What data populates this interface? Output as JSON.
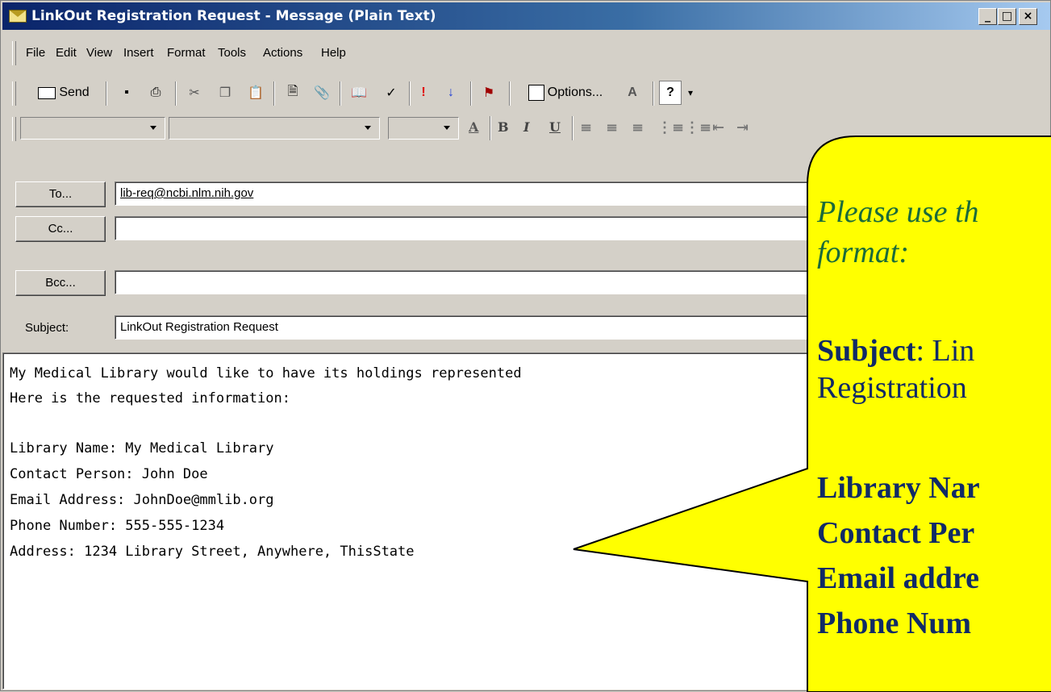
{
  "window": {
    "title": "LinkOut Registration Request - Message (Plain Text)"
  },
  "caption_buttons": {
    "minimize": "_",
    "maximize": "□",
    "close": "×"
  },
  "menu": [
    "File",
    "Edit",
    "View",
    "Insert",
    "Format",
    "Tools",
    "Actions",
    "Help"
  ],
  "toolbar": {
    "send_label": "Send",
    "options_label": "Options...",
    "icons": [
      "save-icon",
      "print-icon",
      "cut-icon",
      "copy-icon",
      "paste-icon",
      "insert-file-icon",
      "attach-icon",
      "address-book-icon",
      "check-names-icon",
      "importance-high-icon",
      "importance-low-icon",
      "flag-icon",
      "options-icon",
      "font-size-icon",
      "help-icon"
    ]
  },
  "formatting": {
    "font_color": "A",
    "bold": "B",
    "italic": "I",
    "underline": "U"
  },
  "header": {
    "to_label": "To...",
    "to_value": "lib-req@ncbi.nlm.nih.gov",
    "cc_label": "Cc...",
    "cc_value": "",
    "bcc_label": "Bcc...",
    "bcc_value": "",
    "subject_label": "Subject:",
    "subject_value": "LinkOut Registration Request"
  },
  "body_lines": [
    "My Medical Library would like to have its holdings represented",
    "Here is the requested information:",
    "",
    "Library Name: My Medical Library",
    "Contact Person: John Doe",
    "Email Address: JohnDoe@mmlib.org",
    "Phone Number: 555-555-1234",
    "Address: 1234 Library Street, Anywhere, ThisState"
  ],
  "callout": {
    "line1": "Please use th",
    "line2": "format:",
    "subject_key": "Subject",
    "subject_rest": ": Lin",
    "subject_line2": "Registration",
    "field1": "Library Nar",
    "field2": "Contact Per",
    "field3": "Email addre",
    "field4": "Phone Num"
  },
  "colors": {
    "callout_fill": "#ffff00",
    "callout_italic": "#1a6b3a",
    "callout_text": "#102a66",
    "titlebar": "#0a246a"
  }
}
